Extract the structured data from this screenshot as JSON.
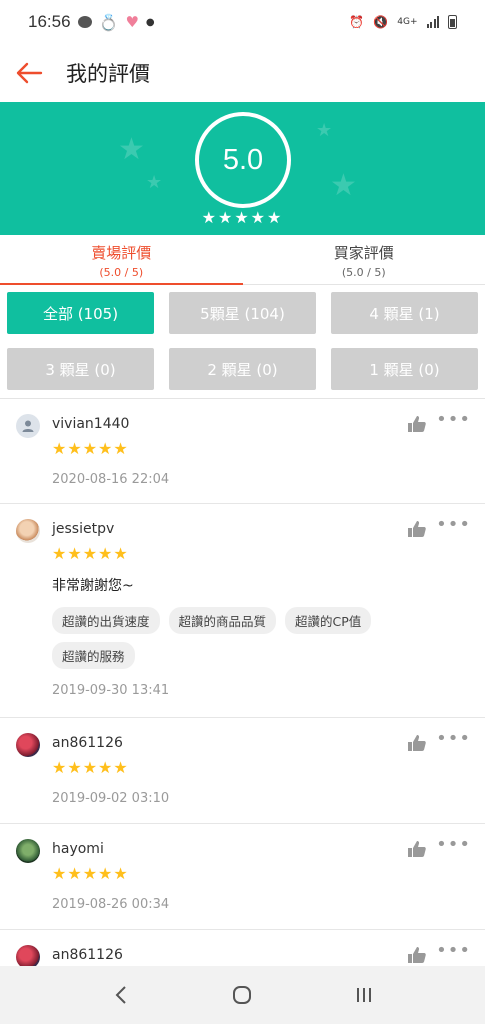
{
  "status": {
    "time": "16:56",
    "network": "4G+"
  },
  "header": {
    "title": "我的評價"
  },
  "hero": {
    "score": "5.0",
    "stars": "★★★★★"
  },
  "tabs": [
    {
      "label": "賣場評價",
      "sub": "(5.0 / 5)",
      "active": true
    },
    {
      "label": "買家評價",
      "sub": "(5.0 / 5)",
      "active": false
    }
  ],
  "filters": [
    {
      "label": "全部 (105)",
      "active": true
    },
    {
      "label": "5顆星 (104)",
      "active": false
    },
    {
      "label": "4 顆星 (1)",
      "active": false
    },
    {
      "label": "3 顆星 (0)",
      "active": false
    },
    {
      "label": "2 顆星 (0)",
      "active": false
    },
    {
      "label": "1 顆星 (0)",
      "active": false
    }
  ],
  "reviews": [
    {
      "user": "vivian1440",
      "stars": "★★★★★",
      "date": "2020-08-16 22:04"
    },
    {
      "user": "jessietpv",
      "stars": "★★★★★",
      "comment": "非常謝謝您~",
      "tags": [
        "超讚的出貨速度",
        "超讚的商品品質",
        "超讚的CP值",
        "超讚的服務"
      ],
      "date": "2019-09-30 13:41"
    },
    {
      "user": "an861126",
      "stars": "★★★★★",
      "date": "2019-09-02 03:10"
    },
    {
      "user": "hayomi",
      "stars": "★★★★★",
      "date": "2019-08-26 00:34"
    },
    {
      "user": "an861126"
    }
  ],
  "colors": {
    "accent": "#ee4d2d",
    "brand": "#10bf9f",
    "star": "#ffbf1c"
  },
  "icons": [
    "back-arrow-icon",
    "thumbs-up-icon",
    "more-icon",
    "nav-back-icon",
    "nav-home-icon",
    "nav-recents-icon"
  ]
}
